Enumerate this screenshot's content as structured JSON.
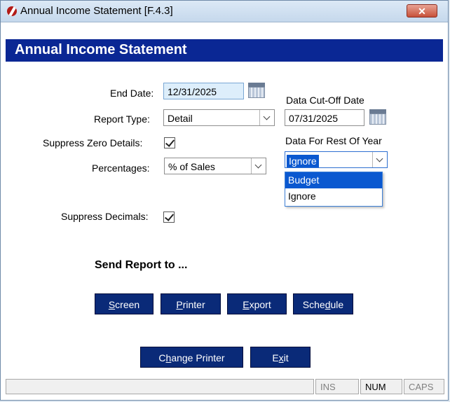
{
  "window": {
    "title": "Annual Income Statement [F.4.3]",
    "close_label": "✕"
  },
  "header": {
    "title": "Annual Income Statement"
  },
  "form": {
    "end_date_label": "End Date:",
    "end_date_value": "12/31/2025",
    "report_type_label": "Report Type:",
    "report_type_value": "Detail",
    "suppress_zero_label": "Suppress Zero Details:",
    "suppress_zero_checked": true,
    "percentages_label": "Percentages:",
    "percentages_value": "% of Sales",
    "suppress_decimals_label": "Suppress Decimals:",
    "suppress_decimals_checked": true,
    "cutoff_label": "Data Cut-Off Date",
    "cutoff_value": "07/31/2025",
    "rest_of_year_label": "Data For Rest Of Year",
    "rest_of_year_value": "Ignore",
    "rest_of_year_options": [
      "Budget",
      "Ignore"
    ]
  },
  "send": {
    "title": "Send Report to ...",
    "screen_u": "S",
    "screen_rest": "creen",
    "printer_u": "P",
    "printer_rest": "rinter",
    "export_u": "E",
    "export_rest": "xport",
    "schedule_pre": "Sche",
    "schedule_u": "d",
    "schedule_rest": "ule"
  },
  "footer_buttons": {
    "change_printer_pre": "C",
    "change_printer_u": "h",
    "change_printer_rest": "ange Printer",
    "exit_pre": "E",
    "exit_u": "x",
    "exit_rest": "it"
  },
  "statusbar": {
    "ins": "INS",
    "num": "NUM",
    "caps": "CAPS"
  }
}
